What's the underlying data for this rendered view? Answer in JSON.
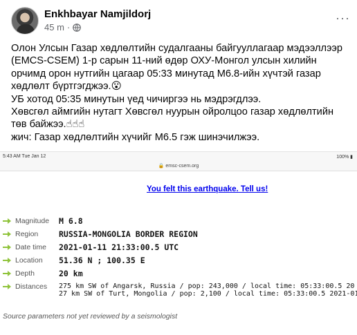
{
  "post": {
    "author": "Enkhbayar Namjildorj",
    "time": "45 m",
    "separator": "·",
    "more": "···",
    "text_lines": [
      "Олон Улсын Газар хөдлөлтийн судалгааны байгууллагаар мэдээллээр (EMCS-CSEM) 1-р сарын 11-ний өдөр ОХУ-Монгол улсын хилийн орчимд орон нутгийн цагаар 05:33 минутад М6.8-ийн хүчтэй газар хөдлөлт бүртгэгджээ.😮",
      "УБ хотод 05:35 минутын үед чичиргээ нь мэдрэгдлээ.",
      "Хөвсгөл аймгийн нутагт Хөвсгөл нуурын ойролцоо газар хөдлөлтийн төв байжээ.☝☝☝",
      "жич: Газар хөдлөлтийн хүчийг М6.5 гэж шинэчилжээ."
    ]
  },
  "screenshot": {
    "status_time": "5:43 AM   Tue Jan 12",
    "status_right": "100% ▮",
    "url": "🔒 emsc-csem.org",
    "felt_link": "You felt this earthquake. Tell us!",
    "params": [
      {
        "label": "Magnitude",
        "value": "M 6.8"
      },
      {
        "label": "Region",
        "value": "RUSSIA-MONGOLIA BORDER REGION"
      },
      {
        "label": "Date time",
        "value": "2021-01-11 21:33:00.5 UTC"
      },
      {
        "label": "Location",
        "value": "51.36 N ; 100.35 E"
      },
      {
        "label": "Depth",
        "value": "20 km"
      }
    ],
    "distances_label": "Distances",
    "distances": [
      "275 km SW of Angarsk, Russia / pop: 243,000 / local time: 05:33:00.5 20",
      "27 km SW of Turt, Mongolia / pop: 2,100 / local time: 05:33:00.5 2021-01"
    ],
    "footnote": "Source parameters not yet reviewed by a seismologist"
  },
  "colors": {
    "arrow": "#8fc33a",
    "link": "#0000ee"
  }
}
